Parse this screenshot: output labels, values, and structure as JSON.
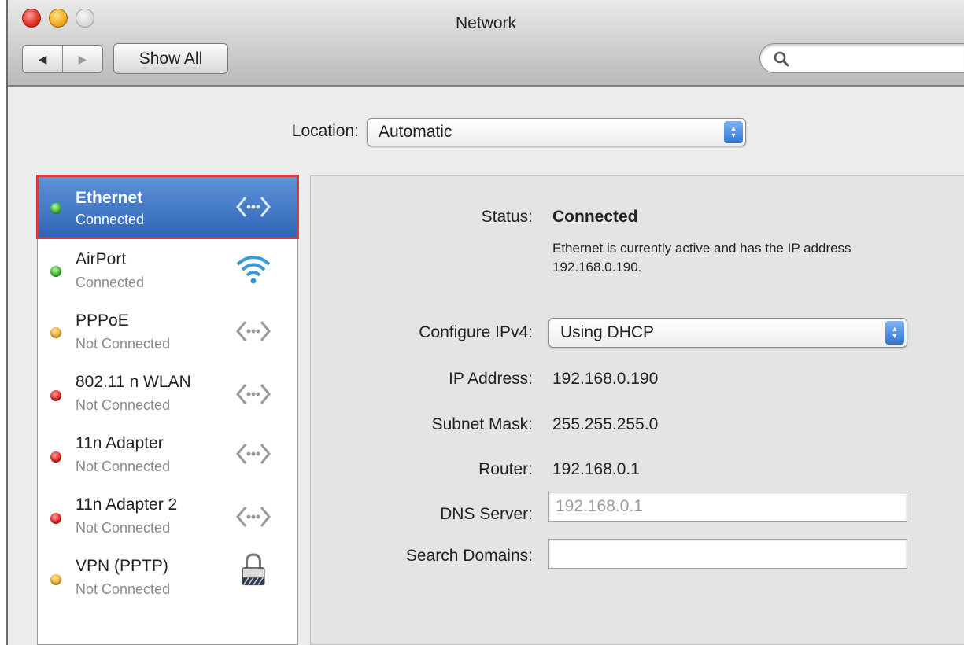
{
  "window": {
    "title": "Network"
  },
  "toolbar": {
    "back_glyph": "◀",
    "forward_glyph": "▶",
    "show_all_label": "Show All",
    "search_placeholder": ""
  },
  "location": {
    "label": "Location:",
    "value": "Automatic"
  },
  "services": [
    {
      "name": "Ethernet",
      "status": "Connected",
      "indicator": "green",
      "icon": "ethernet-icon",
      "selected": true
    },
    {
      "name": "AirPort",
      "status": "Connected",
      "indicator": "green",
      "icon": "wifi-icon",
      "selected": false
    },
    {
      "name": "PPPoE",
      "status": "Not Connected",
      "indicator": "yellow",
      "icon": "ethernet-icon",
      "selected": false
    },
    {
      "name": "802.11 n WLAN",
      "status": "Not Connected",
      "indicator": "red",
      "icon": "ethernet-icon",
      "selected": false
    },
    {
      "name": "11n Adapter",
      "status": "Not Connected",
      "indicator": "red",
      "icon": "ethernet-icon",
      "selected": false
    },
    {
      "name": "11n Adapter 2",
      "status": "Not Connected",
      "indicator": "red",
      "icon": "ethernet-icon",
      "selected": false
    },
    {
      "name": "VPN (PPTP)",
      "status": "Not Connected",
      "indicator": "yellow",
      "icon": "lock-icon",
      "selected": false
    }
  ],
  "detail": {
    "status_label": "Status:",
    "status_value": "Connected",
    "status_description": "Ethernet is currently active and has the IP address 192.168.0.190.",
    "configure_label": "Configure IPv4:",
    "configure_value": "Using DHCP",
    "ip_label": "IP Address:",
    "ip_value": "192.168.0.190",
    "subnet_label": "Subnet Mask:",
    "subnet_value": "255.255.255.0",
    "router_label": "Router:",
    "router_value": "192.168.0.1",
    "dns_label": "DNS Server:",
    "dns_value": "192.168.0.1",
    "search_domains_label": "Search Domains:",
    "search_domains_value": ""
  },
  "colors": {
    "selection": "#3a73c6",
    "highlight_border": "#d63a3e",
    "indicator_green": "#3fba2e",
    "indicator_red": "#e0231e",
    "indicator_yellow": "#f3b12a"
  }
}
